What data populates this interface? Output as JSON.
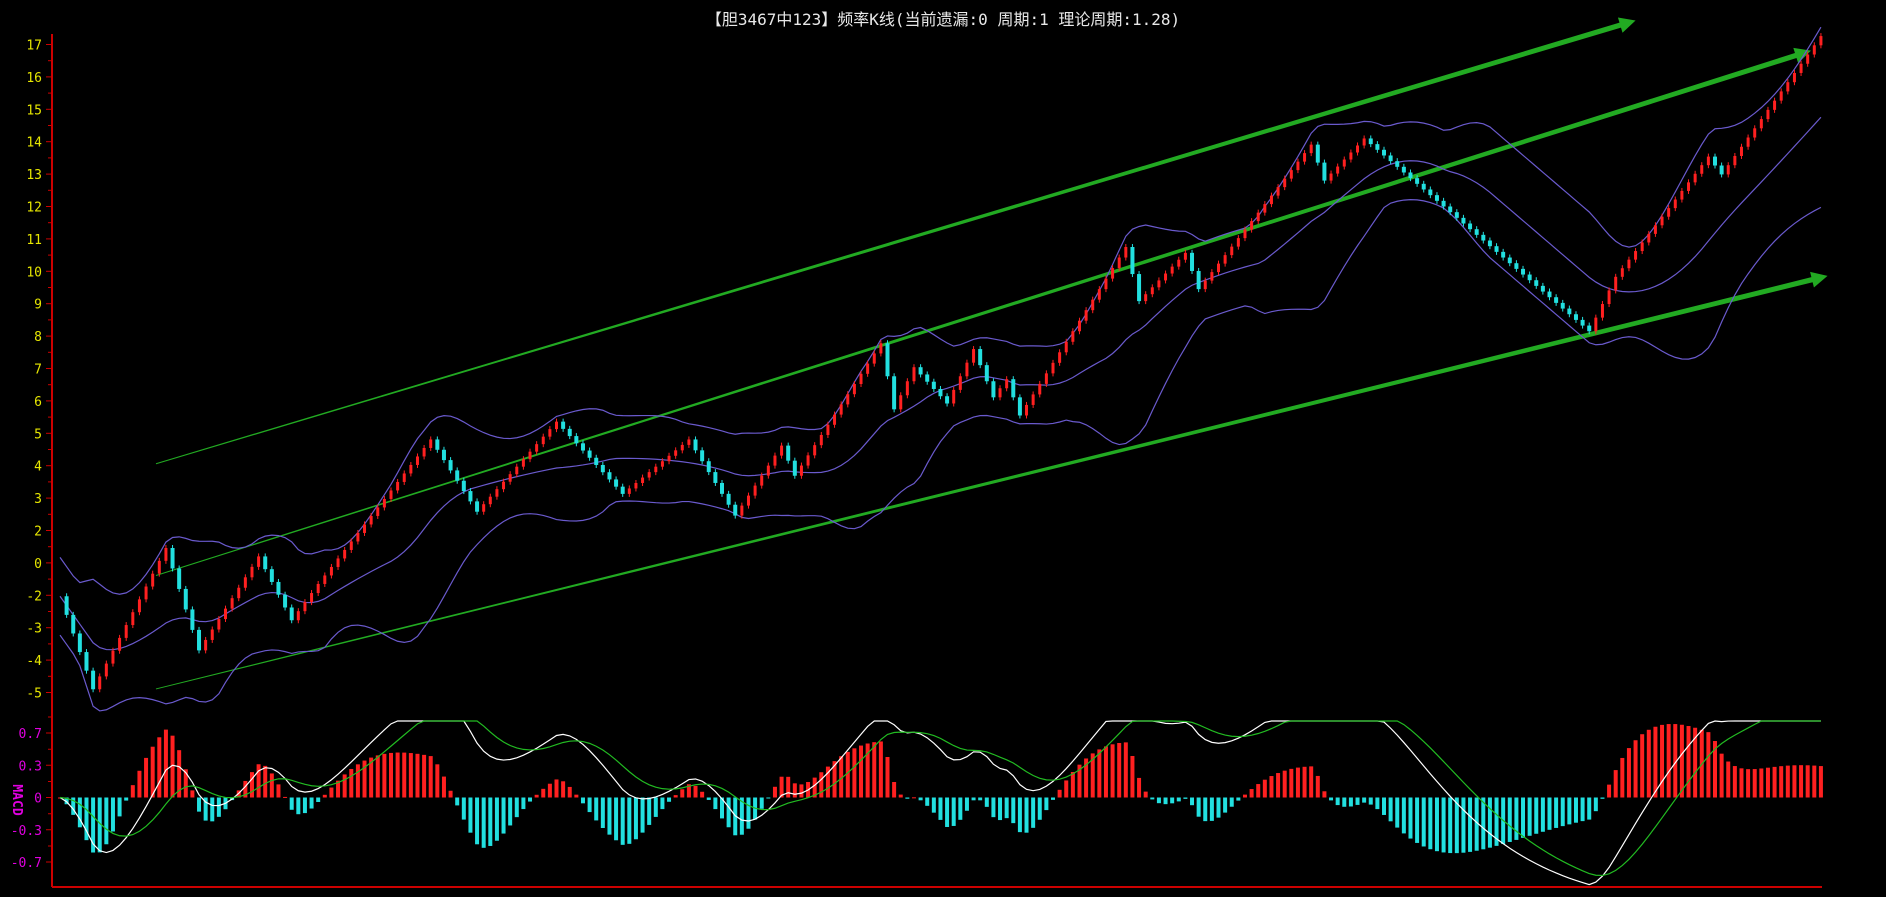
{
  "title": "【胆3467中123】频率K线(当前遗漏:0 周期:1 理论周期:1.28)",
  "chart_data": {
    "type": "candlestick",
    "title": "【胆3467中123】频率K线(当前遗漏:0 周期:1 理论周期:1.28)",
    "xlabel": "",
    "ylabel": "",
    "price_axis": {
      "ylim": [
        -3,
        17
      ],
      "tick_values": [
        17,
        16,
        15,
        14,
        13,
        12,
        11,
        10,
        9,
        8,
        7,
        6,
        5,
        4,
        3,
        2,
        1,
        0,
        -1,
        -2,
        -3
      ],
      "tick_labels": [
        "17",
        "16",
        "15",
        "14",
        "13",
        "12",
        "11",
        "10",
        "9",
        "8",
        "7",
        "6",
        "5",
        "4",
        "3",
        "2",
        "0",
        "-2",
        "-3",
        "-4",
        "-5"
      ]
    },
    "macd_axis": {
      "label": "MACD",
      "ylim": [
        -0.7,
        0.7
      ],
      "tick_labels": [
        "0.7",
        "0.3",
        "0",
        "-0.3",
        "-0.7"
      ]
    },
    "bar_count": 267,
    "price_path": [
      {
        "bar": 0,
        "close": -0.03
      },
      {
        "bar": 5,
        "close": -2.9
      },
      {
        "bar": 16,
        "close": 1.46
      },
      {
        "bar": 21,
        "close": -1.7
      },
      {
        "bar": 30,
        "close": 1.2
      },
      {
        "bar": 35,
        "close": -0.77
      },
      {
        "bar": 39,
        "close": 0.35
      },
      {
        "bar": 56,
        "close": 4.81
      },
      {
        "bar": 63,
        "close": 2.58
      },
      {
        "bar": 75,
        "close": 5.36
      },
      {
        "bar": 85,
        "close": 3.13
      },
      {
        "bar": 95,
        "close": 4.81
      },
      {
        "bar": 102,
        "close": 2.46
      },
      {
        "bar": 109,
        "close": 4.62
      },
      {
        "bar": 111,
        "close": 3.69
      },
      {
        "bar": 124,
        "close": 7.78
      },
      {
        "bar": 126,
        "close": 5.74
      },
      {
        "bar": 129,
        "close": 7.04
      },
      {
        "bar": 134,
        "close": 5.92
      },
      {
        "bar": 138,
        "close": 7.6
      },
      {
        "bar": 141,
        "close": 6.11
      },
      {
        "bar": 143,
        "close": 6.67
      },
      {
        "bar": 145,
        "close": 5.55
      },
      {
        "bar": 161,
        "close": 10.75
      },
      {
        "bar": 163,
        "close": 9.08
      },
      {
        "bar": 170,
        "close": 10.57
      },
      {
        "bar": 172,
        "close": 9.45
      },
      {
        "bar": 189,
        "close": 13.91
      },
      {
        "bar": 191,
        "close": 12.8
      },
      {
        "bar": 197,
        "close": 14.1
      },
      {
        "bar": 231,
        "close": 8.15
      },
      {
        "bar": 235,
        "close": 9.83
      },
      {
        "bar": 249,
        "close": 13.54
      },
      {
        "bar": 251,
        "close": 12.99
      },
      {
        "bar": 266,
        "close": 17.26
      }
    ],
    "indicators": {
      "bollinger": {
        "period": 20,
        "k": 2,
        "color": "#6a5acd"
      },
      "macd": {
        "fast": 12,
        "slow": 26,
        "signal": 9,
        "dif_color": "#ffffff",
        "dea_color": "#22bb22"
      }
    },
    "trend_lines": [
      {
        "from": {
          "bar": 14.5,
          "value": 4.06
        },
        "to": {
          "bar": 238,
          "value": 17.74
        }
      },
      {
        "from": {
          "bar": 14.5,
          "value": 0.61
        },
        "to": {
          "bar": 264.5,
          "value": 16.81
        }
      },
      {
        "from": {
          "bar": 14.5,
          "value": -2.89
        },
        "to": {
          "bar": 267,
          "value": 9.86
        }
      }
    ],
    "colors": {
      "up": "#ff2020",
      "down": "#22e0e0",
      "axis": "#cc0000",
      "trend": "#22aa22"
    }
  }
}
